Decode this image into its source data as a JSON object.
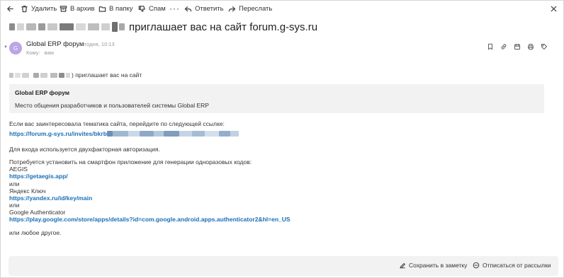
{
  "toolbar": {
    "delete": "Удалить",
    "archive": "В архив",
    "move": "В папку",
    "spam": "Спам",
    "more": "···",
    "reply": "Ответить",
    "forward": "Переслать"
  },
  "subject": {
    "text": "приглашает вас на сайт forum.g-sys.ru"
  },
  "sender": {
    "avatar_letter": "G",
    "avatar_color": "#b9a6e6",
    "name": "Global ERP форум",
    "time": "Сегодня, 10:13",
    "to_label": "Кому:",
    "to_value": "вам"
  },
  "body": {
    "invite_text": ") приглашает вас на сайт",
    "card_title": "Global ERP форум",
    "card_desc": "Место общения разработчиков и пользователей системы Global ERP",
    "intro": "Если вас заинтересовала тематика сайта, перейдите по следующей ссылке:",
    "invite_link": "https://forum.g-sys.ru/invites/bkrb",
    "twofa": "Для входа используется двухфакторная авторизация.",
    "need_app": "Потребуется установить на смартфон приложение для генерации одноразовых кодов:",
    "app1_name": "AEGIS",
    "app1_link": "https://getaegis.app/",
    "or1": "или",
    "app2_name": "Яндекс Ключ",
    "app2_link": "https://yandex.ru/id/key/main",
    "or2": "или",
    "app3_name": "Google Authenticator",
    "app3_link": "https://play.google.com/store/apps/details?id=com.google.android.apps.authenticator2&hl=en_US",
    "other": "или любое другое."
  },
  "footer": {
    "save_note": "Сохранить в заметку",
    "unsubscribe": "Отписаться от рассылки"
  },
  "colors": {
    "link": "#1a6fb5",
    "card_bg": "#f2f2f2"
  }
}
